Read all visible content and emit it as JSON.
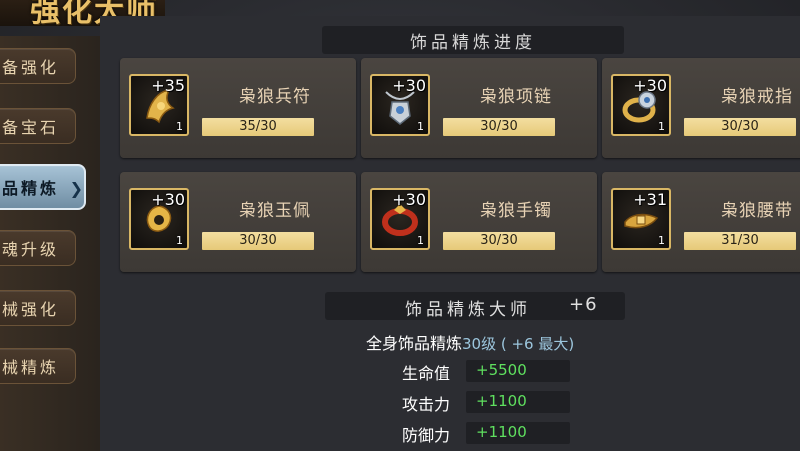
{
  "header": {
    "title_fragment": "强化大师"
  },
  "sidebar": {
    "tabs": [
      {
        "label": "备强化",
        "active": false
      },
      {
        "label": "备宝石",
        "active": false
      },
      {
        "label": "品精炼",
        "active": true
      },
      {
        "label": "魂升级",
        "active": false
      },
      {
        "label": "械强化",
        "active": false
      },
      {
        "label": "械精炼",
        "active": false
      }
    ]
  },
  "progress": {
    "title": "饰品精炼进度",
    "items": [
      {
        "name": "枭狼兵符",
        "level": "+35",
        "qty": "1",
        "progress": "35/30",
        "icon": "tiger-tally-icon"
      },
      {
        "name": "枭狼项链",
        "level": "+30",
        "qty": "1",
        "progress": "30/30",
        "icon": "necklace-icon"
      },
      {
        "name": "枭狼戒指",
        "level": "+30",
        "qty": "1",
        "progress": "30/30",
        "icon": "ring-icon"
      },
      {
        "name": "枭狼玉佩",
        "level": "+30",
        "qty": "1",
        "progress": "30/30",
        "icon": "jade-pendant-icon"
      },
      {
        "name": "枭狼手镯",
        "level": "+30",
        "qty": "1",
        "progress": "30/30",
        "icon": "bracelet-icon"
      },
      {
        "name": "枭狼腰带",
        "level": "+31",
        "qty": "1",
        "progress": "31/30",
        "icon": "belt-icon"
      }
    ]
  },
  "master": {
    "title": "饰品精炼大师",
    "value": "+6",
    "full_label": "全身饰品精炼",
    "full_value": "30级 ( +6 最大)",
    "stats": [
      {
        "label": "生命值",
        "value": "+5500"
      },
      {
        "label": "攻击力",
        "value": "+1100"
      },
      {
        "label": "防御力",
        "value": "+1100"
      }
    ]
  },
  "colors": {
    "gold_accent": "#d9b765",
    "bar_fill": "#e6c978",
    "stat_green": "#5fe05f",
    "active_tab": "#8fb0c6"
  }
}
